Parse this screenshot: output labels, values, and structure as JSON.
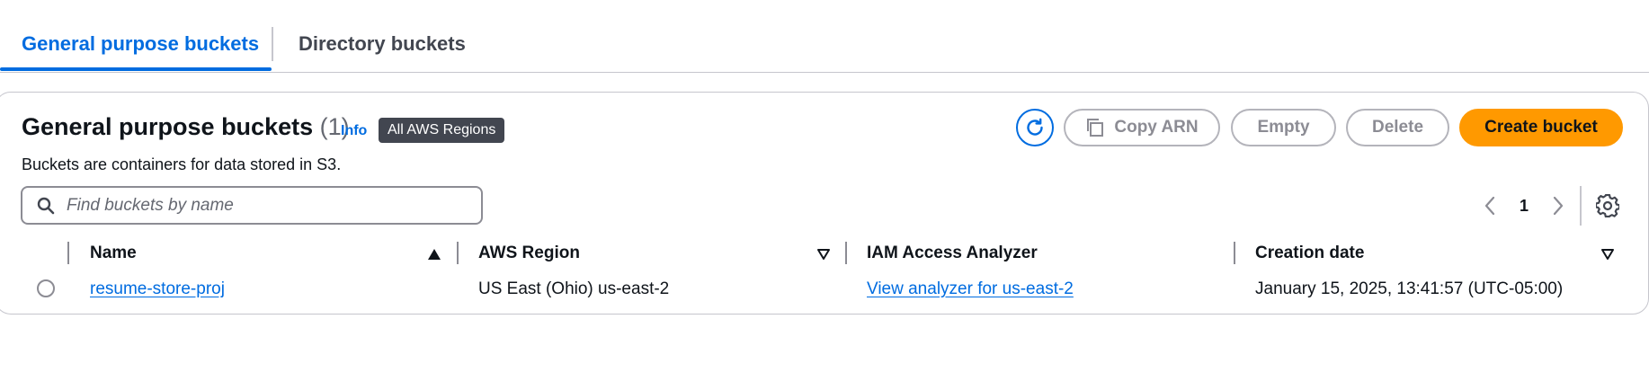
{
  "tabs": [
    {
      "label": "General purpose buckets",
      "active": true
    },
    {
      "label": "Directory buckets",
      "active": false
    }
  ],
  "header": {
    "title": "General purpose buckets",
    "count": "(1)",
    "info": "Info",
    "region_badge": "All AWS Regions",
    "description": "Buckets are containers for data stored in S3."
  },
  "actions": {
    "refresh_icon": "refresh-icon",
    "copy_arn": "Copy ARN",
    "empty": "Empty",
    "delete": "Delete",
    "create": "Create bucket"
  },
  "search": {
    "placeholder": "Find buckets by name",
    "value": ""
  },
  "pagination": {
    "current_page": "1"
  },
  "table": {
    "columns": [
      "Name",
      "AWS Region",
      "IAM Access Analyzer",
      "Creation date"
    ],
    "sort": {
      "column": "Name",
      "direction": "ascending"
    },
    "rows": [
      {
        "name": "resume-store-proj",
        "region": "US East (Ohio) us-east-2",
        "analyzer": "View analyzer for us-east-2",
        "created": "January 15, 2025, 13:41:57 (UTC-05:00)"
      }
    ]
  },
  "colors": {
    "accent": "#006ce0",
    "primary_button": "#ff9900",
    "badge": "#424650",
    "border": "#c6c6cd"
  }
}
